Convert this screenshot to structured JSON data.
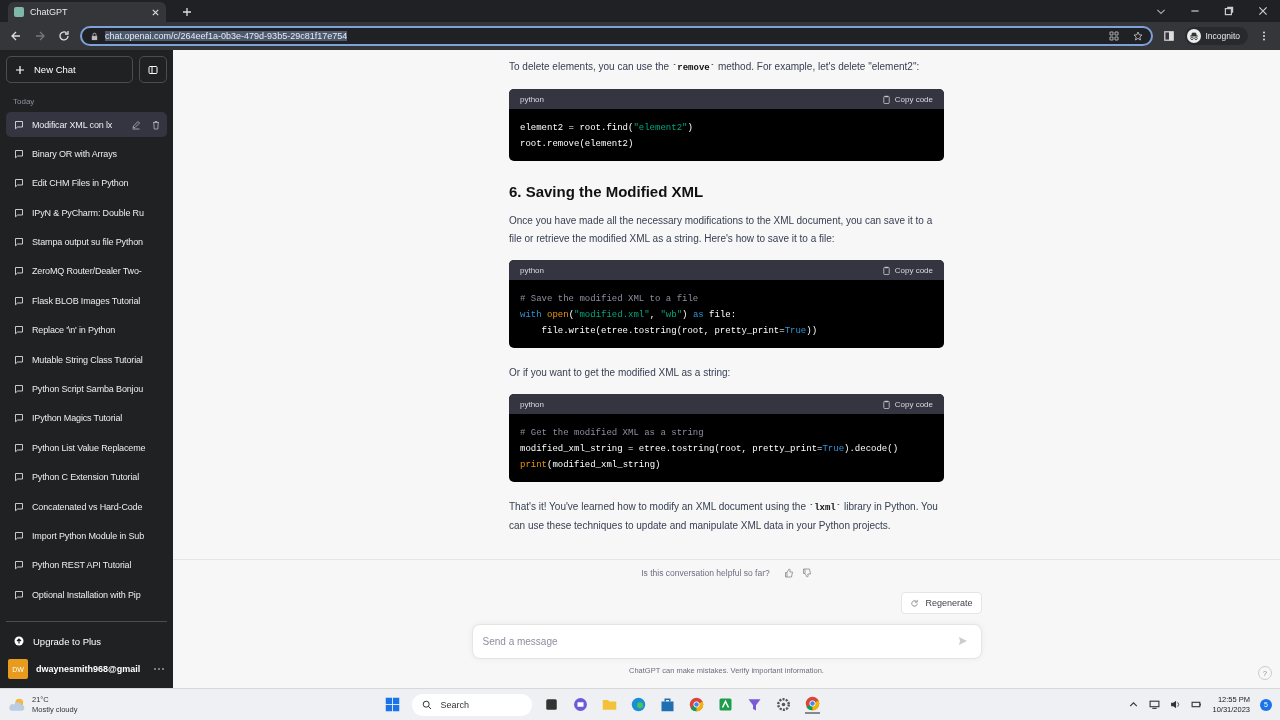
{
  "browser": {
    "tab_title": "ChatGPT",
    "url": "chat.openai.com/c/264eef1a-0b3e-479d-93b5-29c81f17e754",
    "profile": "Incognito"
  },
  "sidebar": {
    "new_chat": "New Chat",
    "section": "Today",
    "chats": [
      {
        "title": "Modificar XML con lx",
        "selected": true
      },
      {
        "title": "Binary OR with Arrays",
        "selected": false
      },
      {
        "title": "Edit CHM Files in Python",
        "selected": false
      },
      {
        "title": "IPyN & PyCharm: Double Ru",
        "selected": false
      },
      {
        "title": "Stampa output su file Python",
        "selected": false
      },
      {
        "title": "ZeroMQ Router/Dealer Two-",
        "selected": false
      },
      {
        "title": "Flask BLOB Images Tutorial",
        "selected": false
      },
      {
        "title": "Replace '\\n' in Python",
        "selected": false
      },
      {
        "title": "Mutable String Class Tutorial",
        "selected": false
      },
      {
        "title": "Python Script Samba Bonjou",
        "selected": false
      },
      {
        "title": "IPython Magics Tutorial",
        "selected": false
      },
      {
        "title": "Python List Value Replaceme",
        "selected": false
      },
      {
        "title": "Python C Extension Tutorial",
        "selected": false
      },
      {
        "title": "Concatenated vs Hard-Code",
        "selected": false
      },
      {
        "title": "Import Python Module in Sub",
        "selected": false
      },
      {
        "title": "Python REST API Tutorial",
        "selected": false
      },
      {
        "title": "Optional Installation with Pip",
        "selected": false
      }
    ],
    "upgrade": "Upgrade to Plus",
    "user": {
      "initials": "DW",
      "email": "dwaynesmith968@gmail"
    }
  },
  "content": [
    {
      "kind": "paragraph",
      "parts": [
        {
          "kind": "text",
          "text": "To delete elements, you can use the "
        },
        {
          "kind": "code",
          "text": "`remove`"
        },
        {
          "kind": "text",
          "text": " method. For example, let's delete \"element2\":"
        }
      ]
    },
    {
      "kind": "code",
      "language": "python",
      "copy": "Copy code",
      "lines": [
        [
          {
            "kind": "plain",
            "text": "element2 = root.find("
          },
          {
            "kind": "string",
            "text": "\"element2\""
          },
          {
            "kind": "plain",
            "text": ")"
          }
        ],
        [
          {
            "kind": "plain",
            "text": "root.remove(element2)"
          }
        ]
      ]
    },
    {
      "kind": "heading",
      "text": "6. Saving the Modified XML"
    },
    {
      "kind": "paragraph",
      "parts": [
        {
          "kind": "text",
          "text": "Once you have made all the necessary modifications to the XML document, you can save it to a file or retrieve the modified XML as a string. Here's how to save it to a file:"
        }
      ]
    },
    {
      "kind": "code",
      "language": "python",
      "copy": "Copy code",
      "lines": [
        [
          {
            "kind": "comment",
            "text": "# Save the modified XML to a file"
          }
        ],
        [
          {
            "kind": "keyword",
            "text": "with "
          },
          {
            "kind": "builtin",
            "text": "open"
          },
          {
            "kind": "plain",
            "text": "("
          },
          {
            "kind": "string",
            "text": "\"modified.xml\""
          },
          {
            "kind": "plain",
            "text": ", "
          },
          {
            "kind": "string",
            "text": "\"wb\""
          },
          {
            "kind": "plain",
            "text": ") "
          },
          {
            "kind": "keyword",
            "text": "as"
          },
          {
            "kind": "plain",
            "text": " file:"
          }
        ],
        [
          {
            "kind": "plain",
            "text": "    file.write(etree.tostring(root, pretty_print="
          },
          {
            "kind": "keyword",
            "text": "True"
          },
          {
            "kind": "plain",
            "text": "))"
          }
        ]
      ]
    },
    {
      "kind": "paragraph",
      "parts": [
        {
          "kind": "text",
          "text": "Or if you want to get the modified XML as a string:"
        }
      ]
    },
    {
      "kind": "code",
      "language": "python",
      "copy": "Copy code",
      "lines": [
        [
          {
            "kind": "comment",
            "text": "# Get the modified XML as a string"
          }
        ],
        [
          {
            "kind": "plain",
            "text": "modified_xml_string = etree.tostring(root, pretty_print="
          },
          {
            "kind": "keyword",
            "text": "True"
          },
          {
            "kind": "plain",
            "text": ").decode()"
          }
        ],
        [
          {
            "kind": "builtin",
            "text": "print"
          },
          {
            "kind": "plain",
            "text": "(modified_xml_string)"
          }
        ]
      ]
    },
    {
      "kind": "paragraph",
      "parts": [
        {
          "kind": "text",
          "text": "That's it! You've learned how to modify an XML document using the "
        },
        {
          "kind": "code",
          "text": "`lxml`"
        },
        {
          "kind": "text",
          "text": " library in Python. You can use these techniques to update and manipulate XML data in your Python projects."
        }
      ]
    }
  ],
  "feedback": "Is this conversation helpful so far?",
  "regenerate": "Regenerate",
  "composer": {
    "placeholder": "Send a message"
  },
  "disclaimer": "ChatGPT can make mistakes. Verify important information.",
  "help": "?",
  "taskbar": {
    "temperature": "21°C",
    "weather": "Mostly cloudy",
    "search": "Search",
    "time": "12:55 PM",
    "date": "10/31/2023",
    "notifications": "5"
  }
}
